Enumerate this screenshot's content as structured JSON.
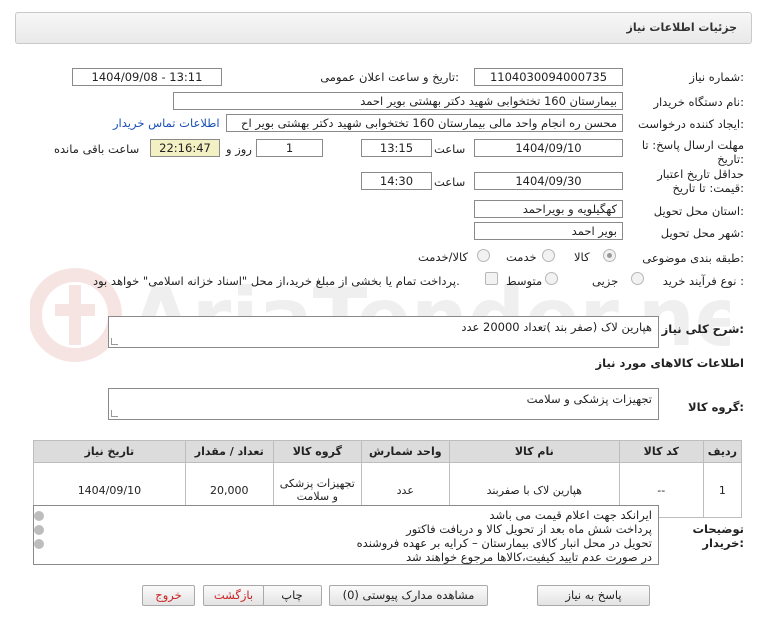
{
  "header": {
    "title": "جزئیات اطلاعات نیاز"
  },
  "fields": {
    "need_number_label": "شماره نیاز:",
    "need_number": "1104030094000735",
    "announce_label": "تاریخ و ساعت اعلان عمومی:",
    "announce_value": "1404/09/08 - 13:11",
    "buyer_label": "نام دستگاه خریدار:",
    "buyer_value": "بیمارستان 160 تختخوابی شهید دکتر بهشتی بویر احمد",
    "creator_label": "ایجاد کننده درخواست:",
    "creator_value": "محسن ره انجام واحد مالی بیمارستان 160 تختخوابی شهید دکتر بهشتی بویر اح",
    "contact_link": "اطلاعات تماس خریدار",
    "deadline_label_1": "مهلت ارسال پاسخ: تا",
    "deadline_label_2": "تاریخ:",
    "deadline_date": "1404/09/10",
    "time_label": "ساعت",
    "deadline_time": "13:15",
    "days_value": "1",
    "days_label": "روز و",
    "remaining_value": "22:16:47",
    "remaining_label": "ساعت باقی مانده",
    "validity_label_1": "حداقل تاریخ اعتبار",
    "validity_label_2": "قیمت: تا تاریخ:",
    "validity_date": "1404/09/30",
    "validity_time_label": "ساعت",
    "validity_time": "14:30",
    "province_label": "استان محل تحویل:",
    "province_value": "کهگیلویه و بویراحمد",
    "city_label": "شهر محل تحویل:",
    "city_value": "بویر احمد",
    "category_label": "طبقه بندی موضوعی:",
    "category_options": [
      "کالا",
      "خدمت",
      "کالا/خدمت"
    ],
    "process_label": "نوع فرآیند خرید :",
    "process_options": [
      "جزیی",
      "متوسط"
    ],
    "payment_note": "پرداخت تمام یا بخشی از مبلغ خرید،از محل \"اسناد خزانه اسلامی\" خواهد بود."
  },
  "description": {
    "label": "شرح کلی نیاز:",
    "value": "هپارین لاک (صفر بند )تعداد 20000 عدد"
  },
  "goods_section": {
    "title": "اطلاعات کالاهای مورد نیاز",
    "group_label": "گروه کالا:",
    "group_value": "تجهیزات پزشکی و سلامت"
  },
  "table": {
    "headers": [
      "ردیف",
      "کد کالا",
      "نام کالا",
      "واحد شمارش",
      "گروه کالا",
      "تعداد / مقدار",
      "تاریخ نیاز"
    ],
    "rows": [
      {
        "row": "1",
        "code": "--",
        "name": "هپارین لاک با صفربند",
        "unit": "عدد",
        "group": "تجهیزات پزشکی و سلامت",
        "qty": "20,000",
        "date": "1404/09/10"
      }
    ]
  },
  "buyer_notes": {
    "label_1": "توضیحات",
    "label_2": "خریدار:",
    "lines": [
      "ایرانکد جهت اعلام قیمت می باشد",
      "پرداخت شش ماه بعد از تحویل کالا و دریافت فاکتور",
      "تحویل در محل انبار کالای بیمارستان – کرایه بر عهده فروشنده",
      "در صورت عدم تایید کیفیت،کالاها مرجوع خواهند شد"
    ]
  },
  "buttons": {
    "reply": "پاسخ به نیاز",
    "attachments": "مشاهده مدارک پیوستی (0)",
    "print": "چاپ",
    "back": "بازگشت",
    "exit": "خروج"
  },
  "watermark": {
    "text": "AriaTender.net"
  }
}
